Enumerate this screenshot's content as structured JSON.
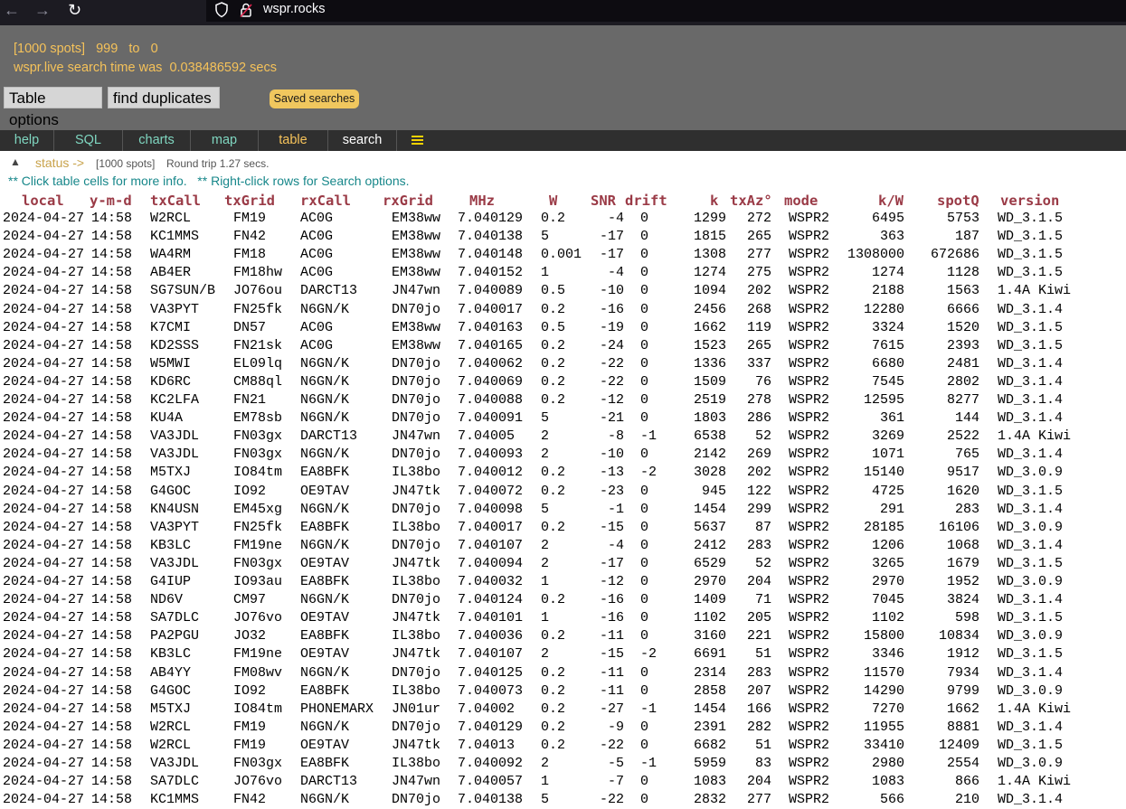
{
  "browser": {
    "url": "wspr.rocks"
  },
  "header": {
    "spots_badge": "[1000 spots]",
    "range_from": "999",
    "range_to_label": "to",
    "range_to": "0",
    "search_time_label": "wspr.live search time was",
    "search_time": "0.038486592 secs",
    "table_options_label": "Table options",
    "find_duplicates_label": "find duplicates",
    "saved_searches_label": "Saved searches"
  },
  "tabs": [
    {
      "label": "help"
    },
    {
      "label": "SQL"
    },
    {
      "label": "charts"
    },
    {
      "label": "map"
    },
    {
      "label": "table"
    },
    {
      "label": "search"
    }
  ],
  "status": {
    "toggle": "▲",
    "label": "status ->",
    "spots": "[1000 spots]",
    "roundtrip": "Round trip 1.27 secs."
  },
  "hint": "** Click table cells for more info.   ** Right-click rows for Search options.",
  "table": {
    "columns": [
      "local",
      "y-m-d",
      "txCall",
      "txGrid",
      "rxCall",
      "rxGrid",
      "MHz",
      "W",
      "SNR",
      "drift",
      "k",
      "txAz°",
      "mode",
      "k/W",
      "spotQ",
      "version"
    ],
    "rows": [
      [
        "2024-04-27",
        "14:58",
        "W2RCL",
        "FM19",
        "AC0G",
        "EM38ww",
        "7.040129",
        "0.2",
        "-4",
        "0",
        "1299",
        "272",
        "WSPR2",
        "6495",
        "5753",
        "WD_3.1.5"
      ],
      [
        "2024-04-27",
        "14:58",
        "KC1MMS",
        "FN42",
        "AC0G",
        "EM38ww",
        "7.040138",
        "5",
        "-17",
        "0",
        "1815",
        "265",
        "WSPR2",
        "363",
        "187",
        "WD_3.1.5"
      ],
      [
        "2024-04-27",
        "14:58",
        "WA4RM",
        "FM18",
        "AC0G",
        "EM38ww",
        "7.040148",
        "0.001",
        "-17",
        "0",
        "1308",
        "277",
        "WSPR2",
        "1308000",
        "672686",
        "WD_3.1.5"
      ],
      [
        "2024-04-27",
        "14:58",
        "AB4ER",
        "FM18hw",
        "AC0G",
        "EM38ww",
        "7.040152",
        "1",
        "-4",
        "0",
        "1274",
        "275",
        "WSPR2",
        "1274",
        "1128",
        "WD_3.1.5"
      ],
      [
        "2024-04-27",
        "14:58",
        "SG7SUN/B",
        "JO76ou",
        "DARCT13",
        "JN47wn",
        "7.040089",
        "0.5",
        "-10",
        "0",
        "1094",
        "202",
        "WSPR2",
        "2188",
        "1563",
        "1.4A Kiwi"
      ],
      [
        "2024-04-27",
        "14:58",
        "VA3PYT",
        "FN25fk",
        "N6GN/K",
        "DN70jo",
        "7.040017",
        "0.2",
        "-16",
        "0",
        "2456",
        "268",
        "WSPR2",
        "12280",
        "6666",
        "WD_3.1.4"
      ],
      [
        "2024-04-27",
        "14:58",
        "K7CMI",
        "DN57",
        "AC0G",
        "EM38ww",
        "7.040163",
        "0.5",
        "-19",
        "0",
        "1662",
        "119",
        "WSPR2",
        "3324",
        "1520",
        "WD_3.1.5"
      ],
      [
        "2024-04-27",
        "14:58",
        "KD2SSS",
        "FN21sk",
        "AC0G",
        "EM38ww",
        "7.040165",
        "0.2",
        "-24",
        "0",
        "1523",
        "265",
        "WSPR2",
        "7615",
        "2393",
        "WD_3.1.5"
      ],
      [
        "2024-04-27",
        "14:58",
        "W5MWI",
        "EL09lq",
        "N6GN/K",
        "DN70jo",
        "7.040062",
        "0.2",
        "-22",
        "0",
        "1336",
        "337",
        "WSPR2",
        "6680",
        "2481",
        "WD_3.1.4"
      ],
      [
        "2024-04-27",
        "14:58",
        "KD6RC",
        "CM88ql",
        "N6GN/K",
        "DN70jo",
        "7.040069",
        "0.2",
        "-22",
        "0",
        "1509",
        "76",
        "WSPR2",
        "7545",
        "2802",
        "WD_3.1.4"
      ],
      [
        "2024-04-27",
        "14:58",
        "KC2LFA",
        "FN21",
        "N6GN/K",
        "DN70jo",
        "7.040088",
        "0.2",
        "-12",
        "0",
        "2519",
        "278",
        "WSPR2",
        "12595",
        "8277",
        "WD_3.1.4"
      ],
      [
        "2024-04-27",
        "14:58",
        "KU4A",
        "EM78sb",
        "N6GN/K",
        "DN70jo",
        "7.040091",
        "5",
        "-21",
        "0",
        "1803",
        "286",
        "WSPR2",
        "361",
        "144",
        "WD_3.1.4"
      ],
      [
        "2024-04-27",
        "14:58",
        "VA3JDL",
        "FN03gx",
        "DARCT13",
        "JN47wn",
        "7.04005",
        "2",
        "-8",
        "-1",
        "6538",
        "52",
        "WSPR2",
        "3269",
        "2522",
        "1.4A Kiwi"
      ],
      [
        "2024-04-27",
        "14:58",
        "VA3JDL",
        "FN03gx",
        "N6GN/K",
        "DN70jo",
        "7.040093",
        "2",
        "-10",
        "0",
        "2142",
        "269",
        "WSPR2",
        "1071",
        "765",
        "WD_3.1.4"
      ],
      [
        "2024-04-27",
        "14:58",
        "M5TXJ",
        "IO84tm",
        "EA8BFK",
        "IL38bo",
        "7.040012",
        "0.2",
        "-13",
        "-2",
        "3028",
        "202",
        "WSPR2",
        "15140",
        "9517",
        "WD_3.0.9"
      ],
      [
        "2024-04-27",
        "14:58",
        "G4GOC",
        "IO92",
        "OE9TAV",
        "JN47tk",
        "7.040072",
        "0.2",
        "-23",
        "0",
        "945",
        "122",
        "WSPR2",
        "4725",
        "1620",
        "WD_3.1.5"
      ],
      [
        "2024-04-27",
        "14:58",
        "KN4USN",
        "EM45xg",
        "N6GN/K",
        "DN70jo",
        "7.040098",
        "5",
        "-1",
        "0",
        "1454",
        "299",
        "WSPR2",
        "291",
        "283",
        "WD_3.1.4"
      ],
      [
        "2024-04-27",
        "14:58",
        "VA3PYT",
        "FN25fk",
        "EA8BFK",
        "IL38bo",
        "7.040017",
        "0.2",
        "-15",
        "0",
        "5637",
        "87",
        "WSPR2",
        "28185",
        "16106",
        "WD_3.0.9"
      ],
      [
        "2024-04-27",
        "14:58",
        "KB3LC",
        "FM19ne",
        "N6GN/K",
        "DN70jo",
        "7.040107",
        "2",
        "-4",
        "0",
        "2412",
        "283",
        "WSPR2",
        "1206",
        "1068",
        "WD_3.1.4"
      ],
      [
        "2024-04-27",
        "14:58",
        "VA3JDL",
        "FN03gx",
        "OE9TAV",
        "JN47tk",
        "7.040094",
        "2",
        "-17",
        "0",
        "6529",
        "52",
        "WSPR2",
        "3265",
        "1679",
        "WD_3.1.5"
      ],
      [
        "2024-04-27",
        "14:58",
        "G4IUP",
        "IO93au",
        "EA8BFK",
        "IL38bo",
        "7.040032",
        "1",
        "-12",
        "0",
        "2970",
        "204",
        "WSPR2",
        "2970",
        "1952",
        "WD_3.0.9"
      ],
      [
        "2024-04-27",
        "14:58",
        "ND6V",
        "CM97",
        "N6GN/K",
        "DN70jo",
        "7.040124",
        "0.2",
        "-16",
        "0",
        "1409",
        "71",
        "WSPR2",
        "7045",
        "3824",
        "WD_3.1.4"
      ],
      [
        "2024-04-27",
        "14:58",
        "SA7DLC",
        "JO76vo",
        "OE9TAV",
        "JN47tk",
        "7.040101",
        "1",
        "-16",
        "0",
        "1102",
        "205",
        "WSPR2",
        "1102",
        "598",
        "WD_3.1.5"
      ],
      [
        "2024-04-27",
        "14:58",
        "PA2PGU",
        "JO32",
        "EA8BFK",
        "IL38bo",
        "7.040036",
        "0.2",
        "-11",
        "0",
        "3160",
        "221",
        "WSPR2",
        "15800",
        "10834",
        "WD_3.0.9"
      ],
      [
        "2024-04-27",
        "14:58",
        "KB3LC",
        "FM19ne",
        "OE9TAV",
        "JN47tk",
        "7.040107",
        "2",
        "-15",
        "-2",
        "6691",
        "51",
        "WSPR2",
        "3346",
        "1912",
        "WD_3.1.5"
      ],
      [
        "2024-04-27",
        "14:58",
        "AB4YY",
        "FM08wv",
        "N6GN/K",
        "DN70jo",
        "7.040125",
        "0.2",
        "-11",
        "0",
        "2314",
        "283",
        "WSPR2",
        "11570",
        "7934",
        "WD_3.1.4"
      ],
      [
        "2024-04-27",
        "14:58",
        "G4GOC",
        "IO92",
        "EA8BFK",
        "IL38bo",
        "7.040073",
        "0.2",
        "-11",
        "0",
        "2858",
        "207",
        "WSPR2",
        "14290",
        "9799",
        "WD_3.0.9"
      ],
      [
        "2024-04-27",
        "14:58",
        "M5TXJ",
        "IO84tm",
        "PHONEMARX",
        "JN01ur",
        "7.04002",
        "0.2",
        "-27",
        "-1",
        "1454",
        "166",
        "WSPR2",
        "7270",
        "1662",
        "1.4A Kiwi"
      ],
      [
        "2024-04-27",
        "14:58",
        "W2RCL",
        "FM19",
        "N6GN/K",
        "DN70jo",
        "7.040129",
        "0.2",
        "-9",
        "0",
        "2391",
        "282",
        "WSPR2",
        "11955",
        "8881",
        "WD_3.1.4"
      ],
      [
        "2024-04-27",
        "14:58",
        "W2RCL",
        "FM19",
        "OE9TAV",
        "JN47tk",
        "7.04013",
        "0.2",
        "-22",
        "0",
        "6682",
        "51",
        "WSPR2",
        "33410",
        "12409",
        "WD_3.1.5"
      ],
      [
        "2024-04-27",
        "14:58",
        "VA3JDL",
        "FN03gx",
        "EA8BFK",
        "IL38bo",
        "7.040092",
        "2",
        "-5",
        "-1",
        "5959",
        "83",
        "WSPR2",
        "2980",
        "2554",
        "WD_3.0.9"
      ],
      [
        "2024-04-27",
        "14:58",
        "SA7DLC",
        "JO76vo",
        "DARCT13",
        "JN47wn",
        "7.040057",
        "1",
        "-7",
        "0",
        "1083",
        "204",
        "WSPR2",
        "1083",
        "866",
        "1.4A Kiwi"
      ],
      [
        "2024-04-27",
        "14:58",
        "KC1MMS",
        "FN42",
        "N6GN/K",
        "DN70jo",
        "7.040138",
        "5",
        "-22",
        "0",
        "2832",
        "277",
        "WSPR2",
        "566",
        "210",
        "WD_3.1.4"
      ]
    ]
  }
}
